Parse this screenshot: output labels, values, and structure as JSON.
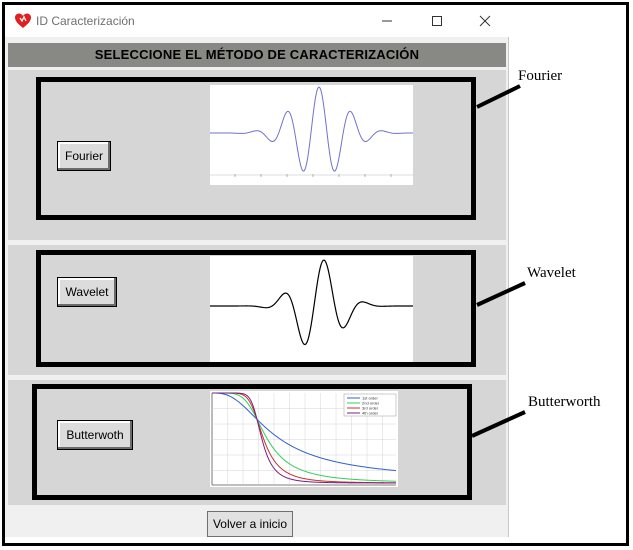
{
  "window": {
    "title": "ID Caracterización",
    "header": "SELECCIONE EL MÉTODO DE CARACTERIZACIÓN",
    "icon": "red-heart-icon"
  },
  "methods": {
    "fourier_label": "Fourier",
    "wavelet_label": "Wavelet",
    "butterworth_label": "Butterwoth"
  },
  "butterworth_legend": [
    "1st order",
    "2nd order",
    "3rd order",
    "4th order"
  ],
  "footer": {
    "back_label": "Volver a inicio"
  },
  "callouts": {
    "fourier": "Fourier",
    "wavelet": "Wavelet",
    "butterworth": "Butterworth"
  },
  "colors": {
    "header_bg": "#888885",
    "panel_bg": "#d6d6d6",
    "fourier_wave": "#6f72cc",
    "butter_series": [
      "#2f5fd0",
      "#2fd05a",
      "#c83030",
      "#7a2080"
    ]
  }
}
